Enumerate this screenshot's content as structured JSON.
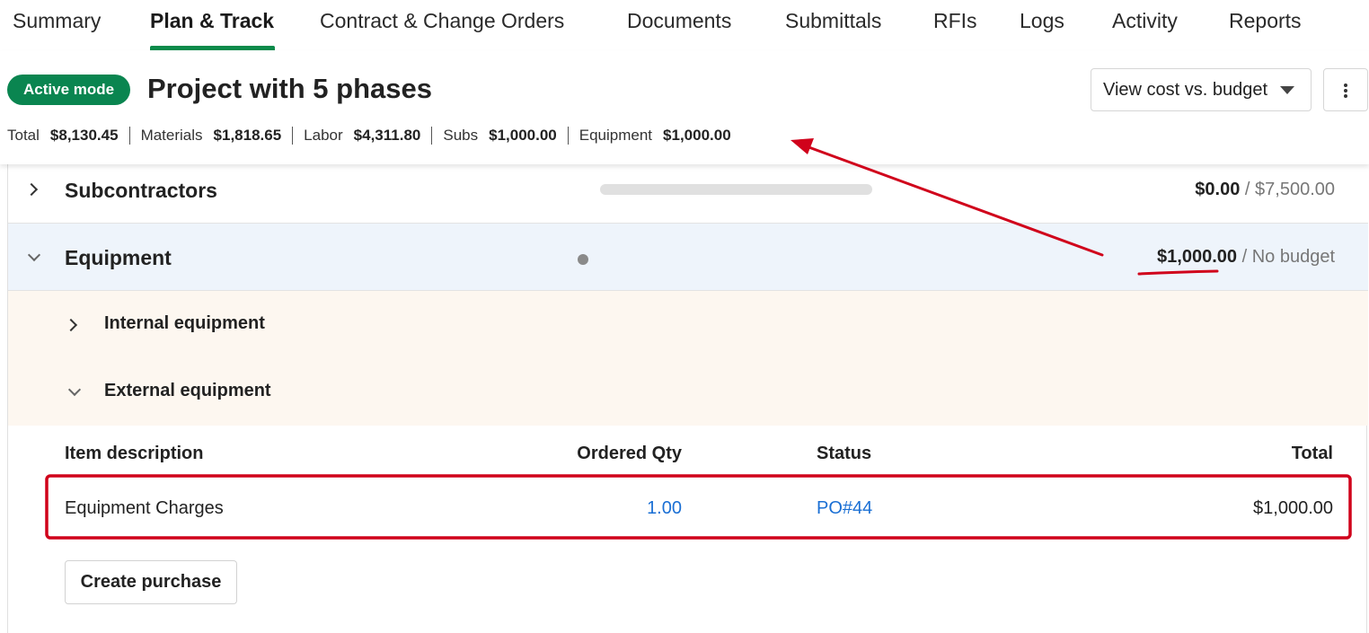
{
  "tabs": [
    {
      "label": "Summary"
    },
    {
      "label": "Plan & Track",
      "active": true
    },
    {
      "label": "Contract & Change Orders"
    },
    {
      "label": "Documents"
    },
    {
      "label": "Submittals"
    },
    {
      "label": "RFIs"
    },
    {
      "label": "Logs"
    },
    {
      "label": "Activity"
    },
    {
      "label": "Reports"
    }
  ],
  "header": {
    "badge": "Active mode",
    "title": "Project with 5 phases",
    "view_button": "View cost vs. budget",
    "totals": [
      {
        "label": "Total",
        "value": "$8,130.45"
      },
      {
        "label": "Materials",
        "value": "$1,818.65"
      },
      {
        "label": "Labor",
        "value": "$4,311.80"
      },
      {
        "label": "Subs",
        "value": "$1,000.00"
      },
      {
        "label": "Equipment",
        "value": "$1,000.00"
      }
    ]
  },
  "sections": {
    "subcontractors": {
      "title": "Subcontractors",
      "spent": "$0.00",
      "separator": "/",
      "budget": "$7,500.00",
      "progress": 0
    },
    "equipment": {
      "title": "Equipment",
      "spent": "$1,000.00",
      "separator": "/",
      "budget": "No budget",
      "subsections": [
        {
          "title": "Internal equipment",
          "expanded": false
        },
        {
          "title": "External equipment",
          "expanded": true
        }
      ]
    }
  },
  "table": {
    "headers": {
      "description": "Item description",
      "qty": "Ordered Qty",
      "status": "Status",
      "total": "Total"
    },
    "rows": [
      {
        "description": "Equipment Charges",
        "qty": "1.00",
        "status": "PO#44",
        "total": "$1,000.00"
      }
    ]
  },
  "create_button": "Create purchase",
  "colors": {
    "brand_green": "#0a8550",
    "link_blue": "#1a6fd4",
    "annotation_red": "#d0021b",
    "expanded_bg": "#eef4fb",
    "subsection_bg": "#fdf7f0"
  }
}
